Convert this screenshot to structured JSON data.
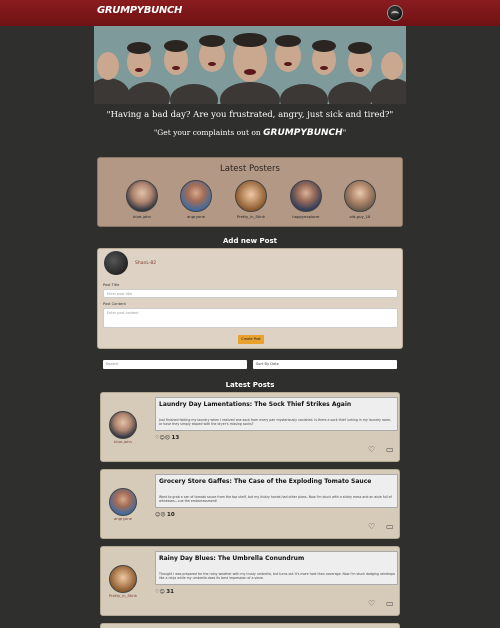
{
  "header": {
    "logo": "GRUMPYBUNCH"
  },
  "hero": {
    "quote1": "\"Having a bad day? Are you frustrated, angry, just sick and tired?\"",
    "quote2_prefix": "\"Get your complaints out on ",
    "quote2_brand": "GRUMPYBUNCH",
    "quote2_suffix": "\""
  },
  "latest_posters": {
    "title": "Latest Posters",
    "users": [
      {
        "name": "blue-john"
      },
      {
        "name": "angryone"
      },
      {
        "name": "Pretty_in_Stink"
      },
      {
        "name": "happyexplorer"
      },
      {
        "name": "old-guy_18"
      }
    ]
  },
  "new_post": {
    "title": "Add new Post",
    "username": "ShanL-82",
    "post_title_label": "Post Title",
    "post_title_placeholder": "Enter post title",
    "post_content_label": "Post Content",
    "post_content_placeholder": "Enter post content",
    "create_button": "Create Post"
  },
  "filters": {
    "search_placeholder": "Search",
    "sort_label": "Sort By Date"
  },
  "latest_posts": {
    "title": "Latest Posts",
    "posts": [
      {
        "author": "blue-john",
        "title": "Laundry Day Lamentations: The Sock Thief Strikes Again",
        "body": "Just finished folding my laundry when I realized one sock from every pair mysteriously vanished. Is there a sock thief lurking in my laundry room, or have they simply eloped with the dryer's missing socks?",
        "count": "13"
      },
      {
        "author": "angryone",
        "title": "Grocery Store Gaffes: The Case of the Exploding Tomato Sauce",
        "body": "Went to grab a can of tomato sauce from the top shelf, but my klutzy hands had other plans. Now I'm stuck with a sticky mess and an aisle full of witnesses—cue the embarrassment!",
        "count": "10"
      },
      {
        "author": "Pretty_in_Stink",
        "title": "Rainy Day Blues: The Umbrella Conundrum",
        "body": "Thought I was prepared for the rainy weather with my trusty umbrella, but turns out it's more hole than coverage. Now I'm stuck dodging raindrops like a ninja while my umbrella does its best impression of a sieve.",
        "count": "31"
      }
    ]
  }
}
